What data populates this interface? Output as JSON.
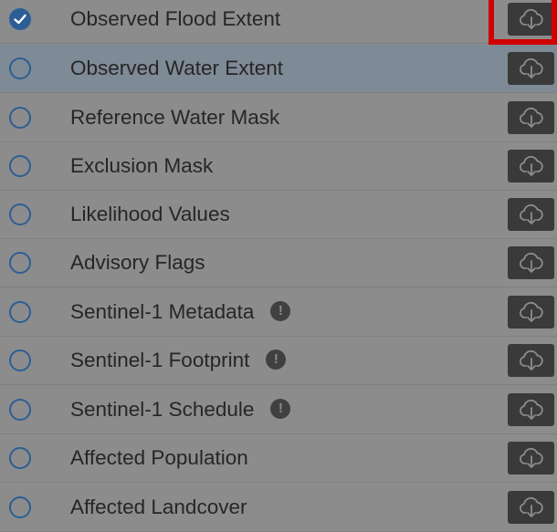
{
  "colors": {
    "overlay": "#8c8c8c",
    "radio_blue": "#2b5e95",
    "highlight_row": "#7e8a95",
    "download_button": "#3a3a3a",
    "callout_red": "#d10000"
  },
  "layers": [
    {
      "label": "Observed Flood Extent",
      "checked": true,
      "info": false,
      "icon": "cloud-download-icon"
    },
    {
      "label": "Observed Water Extent",
      "checked": false,
      "info": false,
      "icon": "cloud-download-icon"
    },
    {
      "label": "Reference Water Mask",
      "checked": false,
      "info": false,
      "icon": "cloud-download-icon"
    },
    {
      "label": "Exclusion Mask",
      "checked": false,
      "info": false,
      "icon": "cloud-download-icon"
    },
    {
      "label": "Likelihood Values",
      "checked": false,
      "info": false,
      "icon": "cloud-download-icon"
    },
    {
      "label": "Advisory Flags",
      "checked": false,
      "info": false,
      "icon": "cloud-download-icon"
    },
    {
      "label": "Sentinel-1 Metadata",
      "checked": false,
      "info": true,
      "icon": "cloud-download-icon"
    },
    {
      "label": "Sentinel-1 Footprint",
      "checked": false,
      "info": true,
      "icon": "cloud-download-icon"
    },
    {
      "label": "Sentinel-1 Schedule",
      "checked": false,
      "info": true,
      "icon": "cloud-download-icon"
    },
    {
      "label": "Affected Population",
      "checked": false,
      "info": false,
      "icon": "cloud-download-icon"
    },
    {
      "label": "Affected Landcover",
      "checked": false,
      "info": false,
      "icon": "cloud-download-icon"
    }
  ],
  "info_glyph": "!"
}
